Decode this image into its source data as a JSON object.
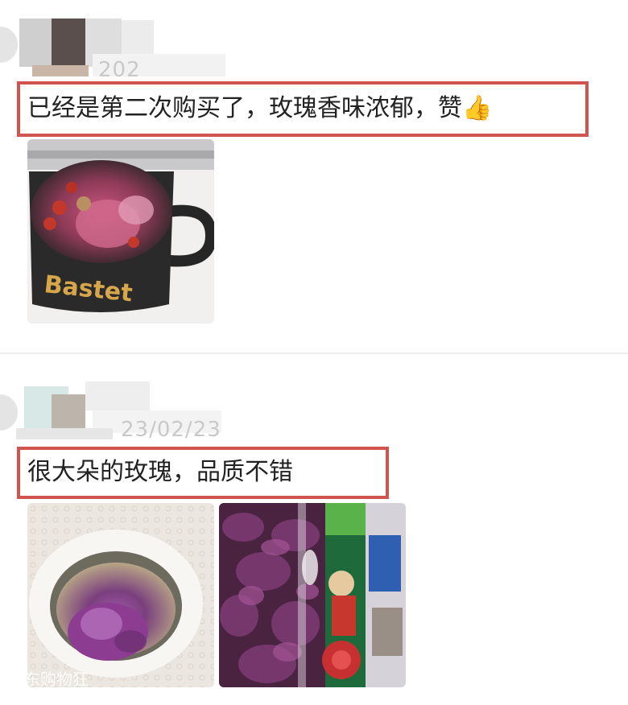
{
  "reviews": [
    {
      "date": "202",
      "text": "已经是第二次购买了，玫瑰香味浓郁，赞",
      "emoji": "👍",
      "photos": [
        {
          "alt": "mug-with-rose-tea",
          "mug_brand": "Bastet"
        }
      ]
    },
    {
      "date": "23/02/23",
      "text": "很大朵的玫瑰，品质不错",
      "photos": [
        {
          "alt": "cup-with-rose-tea",
          "watermark": "东购物狂"
        },
        {
          "alt": "bottle-with-rose-petals"
        }
      ]
    }
  ],
  "colors": {
    "highlight": "#d2544f",
    "text": "#222222",
    "muted": "#c9c9c9"
  }
}
